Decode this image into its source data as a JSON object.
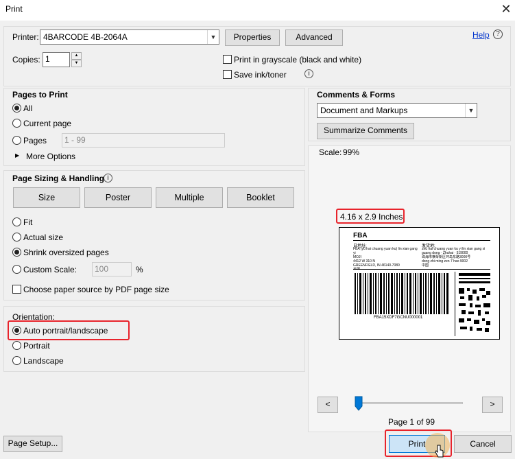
{
  "window": {
    "title": "Print",
    "close": "✕"
  },
  "printer": {
    "label": "Printer:",
    "selected": "4BARCODE 4B-2064A",
    "properties_label": "Properties",
    "advanced_label": "Advanced",
    "help_label": "Help"
  },
  "copies": {
    "label": "Copies:",
    "value": "1"
  },
  "options": {
    "grayscale_label": "Print in grayscale (black and white)",
    "save_ink_label": "Save ink/toner"
  },
  "pages_to_print": {
    "title": "Pages to Print",
    "all_label": "All",
    "current_label": "Current page",
    "pages_label": "Pages",
    "pages_placeholder": "1 - 99",
    "more_options_label": "More Options"
  },
  "sizing": {
    "title": "Page Sizing & Handling",
    "tabs": [
      "Size",
      "Poster",
      "Multiple",
      "Booklet"
    ],
    "fit_label": "Fit",
    "actual_label": "Actual size",
    "shrink_label": "Shrink oversized pages",
    "custom_label": "Custom Scale:",
    "custom_value": "100",
    "percent": "%",
    "paper_source_label": "Choose paper source by PDF page size"
  },
  "orientation": {
    "title": "Orientation:",
    "auto_label": "Auto portrait/landscape",
    "portrait_label": "Portrait",
    "landscape_label": "Landscape"
  },
  "comments": {
    "title": "Comments & Forms",
    "selected": "Document and Markups",
    "summarize_label": "Summarize Comments"
  },
  "preview": {
    "scale_label": "Scale:",
    "scale_value": "99%",
    "dimensions": "4.16 x 2.9 Inches",
    "label_fba": "FBA",
    "label_from_left": "日地址:",
    "label_from_right": "发货地:",
    "label_left_text": "FBA (yu hai chuang yuan ku) lin xian gang yi\nMOJI\n4412 W 310 N\nGREENFIELD, IN 46140-7080\n美国",
    "label_right_text": "zhu hai chuang yuan ku yi lin xian gang xi\nguang dong · Zhuhai · 519000\n珠海市横琴新区环岛东路3000号\ndong zhi ming zen 7 hao 9002\n中国",
    "barcode_text": "FBA15XDF7GCNU000001",
    "page_indicator": "Page 1 of 99",
    "prev": "<",
    "next": ">",
    "slider_position": 0
  },
  "footer": {
    "page_setup_label": "Page Setup...",
    "print_label": "Print",
    "cancel_label": "Cancel"
  },
  "colors": {
    "highlight_red": "#e8232b",
    "print_button_blue": "#cce4f7",
    "slider_blue": "#0078d7"
  }
}
